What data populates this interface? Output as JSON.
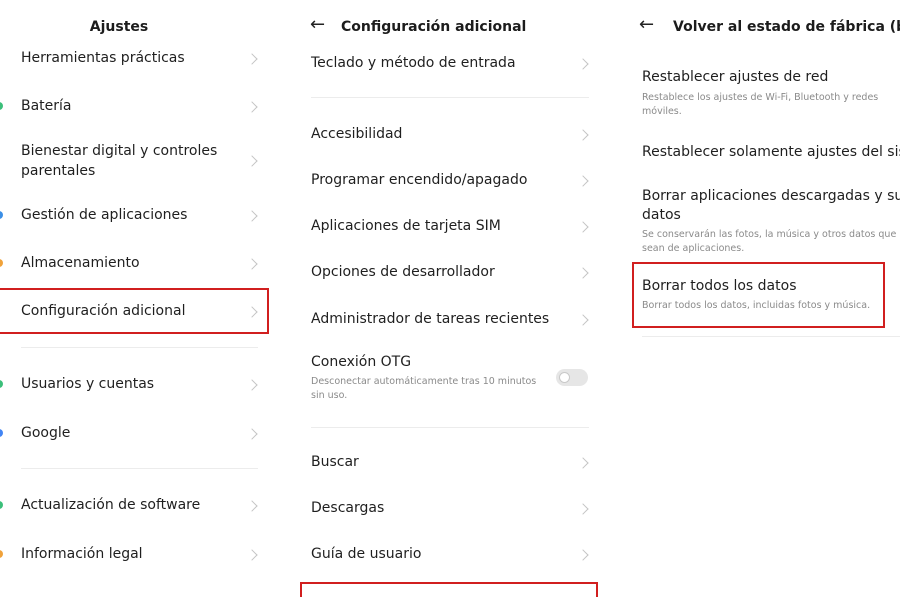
{
  "panel1": {
    "title": "Ajustes",
    "items": [
      {
        "label": "Herramientas prácticas"
      },
      {
        "label": "Batería"
      },
      {
        "label": "Bienestar digital y controles parentales",
        "line1": "Bienestar digital y controles",
        "line2": "parentales"
      },
      {
        "label": "Gestión de aplicaciones"
      },
      {
        "label": "Almacenamiento"
      },
      {
        "label": "Configuración adicional"
      },
      {
        "label": "Usuarios y cuentas"
      },
      {
        "label": "Google"
      },
      {
        "label": "Actualización de software"
      },
      {
        "label": "Información legal"
      }
    ]
  },
  "panel2": {
    "back_icon": "←",
    "title": "Configuración adicional",
    "items": [
      {
        "label": "Teclado y método de entrada"
      },
      {
        "label": "Accesibilidad"
      },
      {
        "label": "Programar encendido/apagado"
      },
      {
        "label": "Aplicaciones de tarjeta SIM"
      },
      {
        "label": "Opciones de desarrollador"
      },
      {
        "label": "Administrador de tareas recientes"
      },
      {
        "label": "Conexión OTG",
        "subtitle_line1": "Desconectar automáticamente tras 10 minutos",
        "subtitle_line2": "sin uso.",
        "toggle_on": false
      },
      {
        "label": "Buscar"
      },
      {
        "label": "Descargas"
      },
      {
        "label": "Guía de usuario"
      }
    ]
  },
  "panel3": {
    "back_icon": "←",
    "title": "Volver al estado de fábrica (borrar to",
    "items": [
      {
        "label": "Restablecer ajustes de red",
        "subtitle_line1": "Restablece los ajustes de Wi-Fi, Bluetooth y redes",
        "subtitle_line2": "móviles."
      },
      {
        "label": "Restablecer solamente ajustes del sistem"
      },
      {
        "label_line1": "Borrar aplicaciones descargadas y sus",
        "label_line2": "datos",
        "subtitle_line1": "Se conservarán las fotos, la música y otros datos que n",
        "subtitle_line2": "sean de aplicaciones."
      },
      {
        "label": "Borrar todos los datos",
        "subtitle": "Borrar todos los datos, incluidas fotos y música."
      }
    ]
  },
  "colors": {
    "highlight": "#d11f1f",
    "divider": "#ececec",
    "subtitle": "#8a8a8a"
  }
}
